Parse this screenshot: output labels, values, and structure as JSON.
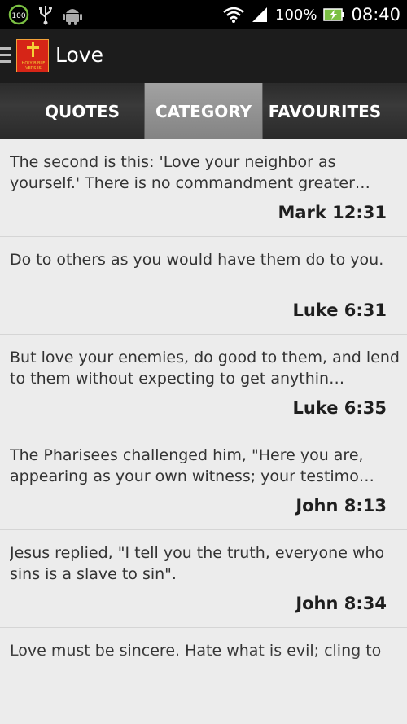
{
  "status_bar": {
    "battery_badge": "100",
    "battery_percent": "100%",
    "time": "08:40",
    "icons": [
      "battery-saver-icon",
      "usb-icon",
      "android-icon",
      "wifi-icon",
      "signal-icon",
      "charging-battery-icon"
    ]
  },
  "action_bar": {
    "title": "Love",
    "app_icon_text": "HOLY BIBLE VERSES",
    "menu_icon": "drawer-menu-icon"
  },
  "tabs": [
    {
      "label": "QUOTES",
      "selected": false
    },
    {
      "label": "CATEGORY",
      "selected": true
    },
    {
      "label": "FAVOURITES",
      "selected": false
    }
  ],
  "verses": [
    {
      "text": "The second is this: 'Love your neighbor as yourself.' There is no commandment greater…",
      "ref": "Mark 12:31"
    },
    {
      "text": "Do to others as you would have them do to you.",
      "ref": "Luke 6:31"
    },
    {
      "text": "But love your enemies, do good to them, and lend to them without expecting to get anythin…",
      "ref": "Luke 6:35"
    },
    {
      "text": "The Pharisees challenged him, \"Here you are, appearing as your own witness; your testimo…",
      "ref": "John 8:13"
    },
    {
      "text": "Jesus replied, \"I tell you the truth, everyone who sins is a slave to sin\".",
      "ref": "John 8:34"
    },
    {
      "text": "Love must be sincere. Hate what is evil; cling to",
      "ref": ""
    }
  ],
  "colors": {
    "status_bar": "#000000",
    "action_bar": "#1c1c1c",
    "tab_bar": "#2e2e2e",
    "tab_selected": "#939393",
    "list_bg": "#ececec",
    "app_icon_red": "#d62517",
    "app_icon_gold": "#f4d036"
  }
}
